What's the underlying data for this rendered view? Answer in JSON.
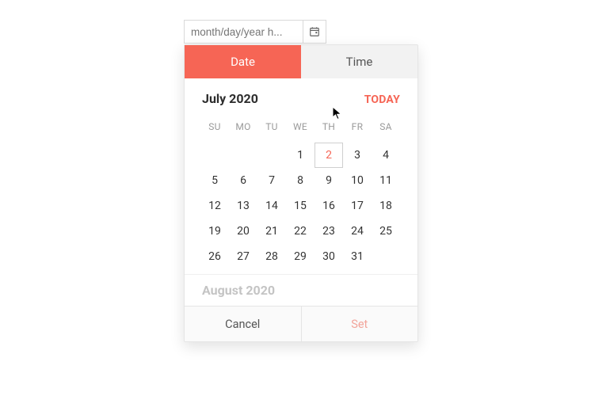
{
  "colors": {
    "accent": "#f66555"
  },
  "input": {
    "placeholder": "month/day/year h...",
    "value": "",
    "icon_name": "calendar-icon"
  },
  "tabs": {
    "date_label": "Date",
    "time_label": "Time",
    "active": "date"
  },
  "today_label": "TODAY",
  "months": [
    {
      "title": "July 2020",
      "weekday_short": [
        "SU",
        "MO",
        "TU",
        "WE",
        "TH",
        "FR",
        "SA"
      ],
      "first_weekday_index": 3,
      "days_in_month": 31,
      "today_day": 2
    },
    {
      "title": "August 2020"
    }
  ],
  "footer": {
    "cancel_label": "Cancel",
    "set_label": "Set"
  }
}
